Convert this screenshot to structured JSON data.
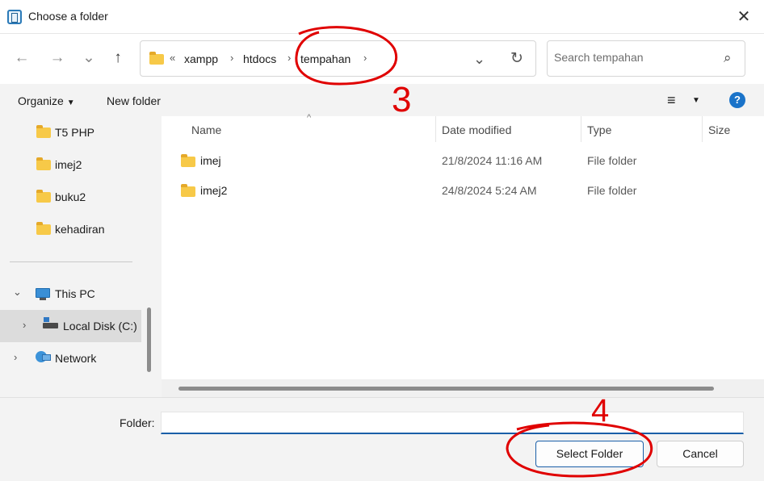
{
  "window": {
    "title": "Choose a folder",
    "close_icon": "close-icon"
  },
  "nav": {
    "back_icon": "←",
    "forward_icon": "→",
    "recent_icon": "⌄",
    "up_icon": "↑",
    "overflow": "«",
    "crumbs": [
      "xampp",
      "htdocs",
      "tempahan"
    ],
    "dropdown_icon": "⌄",
    "refresh_icon": "↻",
    "search_placeholder": "Search tempahan",
    "search_icon": "⌕"
  },
  "toolbar": {
    "organize": "Organize",
    "new_folder": "New folder",
    "view_icon": "≡",
    "help": "?"
  },
  "tree": [
    {
      "label": "T5 PHP",
      "icon": "folder"
    },
    {
      "label": "imej2",
      "icon": "folder"
    },
    {
      "label": "buku2",
      "icon": "folder"
    },
    {
      "label": "kehadiran",
      "icon": "folder"
    },
    {
      "label": "This PC",
      "icon": "monitor",
      "expanded": true
    },
    {
      "label": "Local Disk (C:)",
      "icon": "drive",
      "selected": true
    },
    {
      "label": "Network",
      "icon": "network"
    }
  ],
  "columns": {
    "name": "Name",
    "date": "Date modified",
    "type": "Type",
    "size": "Size"
  },
  "files": [
    {
      "name": "imej",
      "date": "21/8/2024 11:16 AM",
      "type": "File folder"
    },
    {
      "name": "imej2",
      "date": "24/8/2024 5:24 AM",
      "type": "File folder"
    }
  ],
  "footer": {
    "folder_label": "Folder:",
    "folder_value": "",
    "select": "Select Folder",
    "cancel": "Cancel"
  },
  "annotations": {
    "note_3": "3",
    "note_4": "4",
    "color": "#e00000"
  },
  "colors": {
    "accent": "#1a5fa8",
    "folder": "#f7c948",
    "help": "#1a73c9"
  }
}
